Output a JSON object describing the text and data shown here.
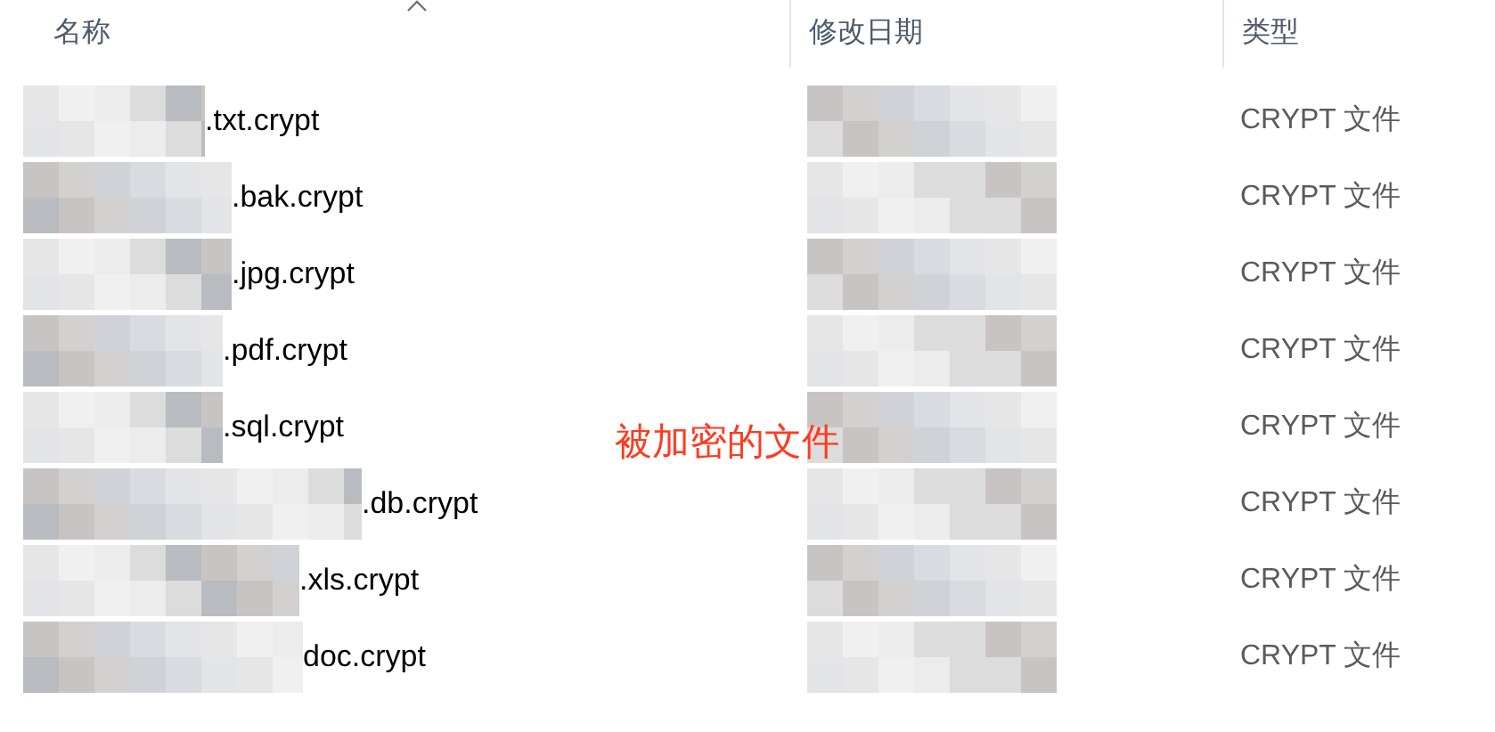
{
  "columns": [
    {
      "label": "名称",
      "sorted": true
    },
    {
      "label": "修改日期",
      "sorted": false
    },
    {
      "label": "类型",
      "sorted": false
    }
  ],
  "rows": [
    {
      "name": ".txt.crypt",
      "type": "CRYPT 文件"
    },
    {
      "name": ".bak.crypt",
      "type": "CRYPT 文件"
    },
    {
      "name": ".jpg.crypt",
      "type": "CRYPT 文件"
    },
    {
      "name": ".pdf.crypt",
      "type": "CRYPT 文件"
    },
    {
      "name": ".sql.crypt",
      "type": "CRYPT 文件"
    },
    {
      "name": ".db.crypt",
      "type": "CRYPT 文件"
    },
    {
      "name": ".xls.crypt",
      "type": "CRYPT 文件"
    },
    {
      "name": "doc.crypt",
      "type": "CRYPT 文件"
    }
  ],
  "annotation": "被加密的文件"
}
